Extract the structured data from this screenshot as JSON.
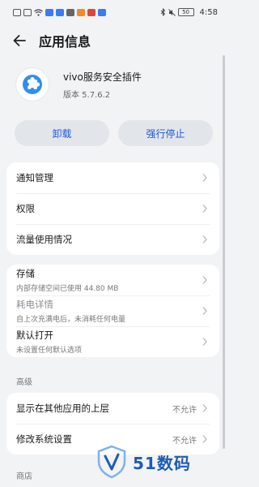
{
  "status_bar": {
    "left_icons": [
      "gallery-icon",
      "gallery-icon",
      "wifi-icon",
      "app-notification-icon",
      "app-notification-icon",
      "app-notification-icon",
      "app-notification-icon",
      "app-notification-icon",
      "app-notification-icon"
    ],
    "battery": "50",
    "time": "4:58"
  },
  "header": {
    "title": "应用信息"
  },
  "app": {
    "name": "vivo服务安全插件",
    "version": "版本 5.7.6.2",
    "icon": "puzzle-icon",
    "icon_color": "#2f8ef0"
  },
  "actions": {
    "uninstall": "卸载",
    "force_stop": "强行停止"
  },
  "group1": [
    {
      "title": "通知管理"
    },
    {
      "title": "权限"
    },
    {
      "title": "流量使用情况"
    }
  ],
  "group2": [
    {
      "title": "存储",
      "sub": "内部存储空间已使用 44.80 MB"
    },
    {
      "title": "耗电详情",
      "sub": "自上次充满电后，未消耗任何电量"
    },
    {
      "title": "默认打开",
      "sub": "未设置任何默认选项"
    }
  ],
  "section_advanced": "高级",
  "group3": [
    {
      "title": "显示在其他应用的上层",
      "value": "不允许"
    },
    {
      "title": "修改系统设置",
      "value": "不允许"
    }
  ],
  "section_store": "商店",
  "watermark": {
    "text": "51数码",
    "color": "#1f5ab5"
  },
  "colors": {
    "accent": "#1f57d6",
    "background": "#f1f3f5",
    "button_bg": "#e2e5ea"
  }
}
